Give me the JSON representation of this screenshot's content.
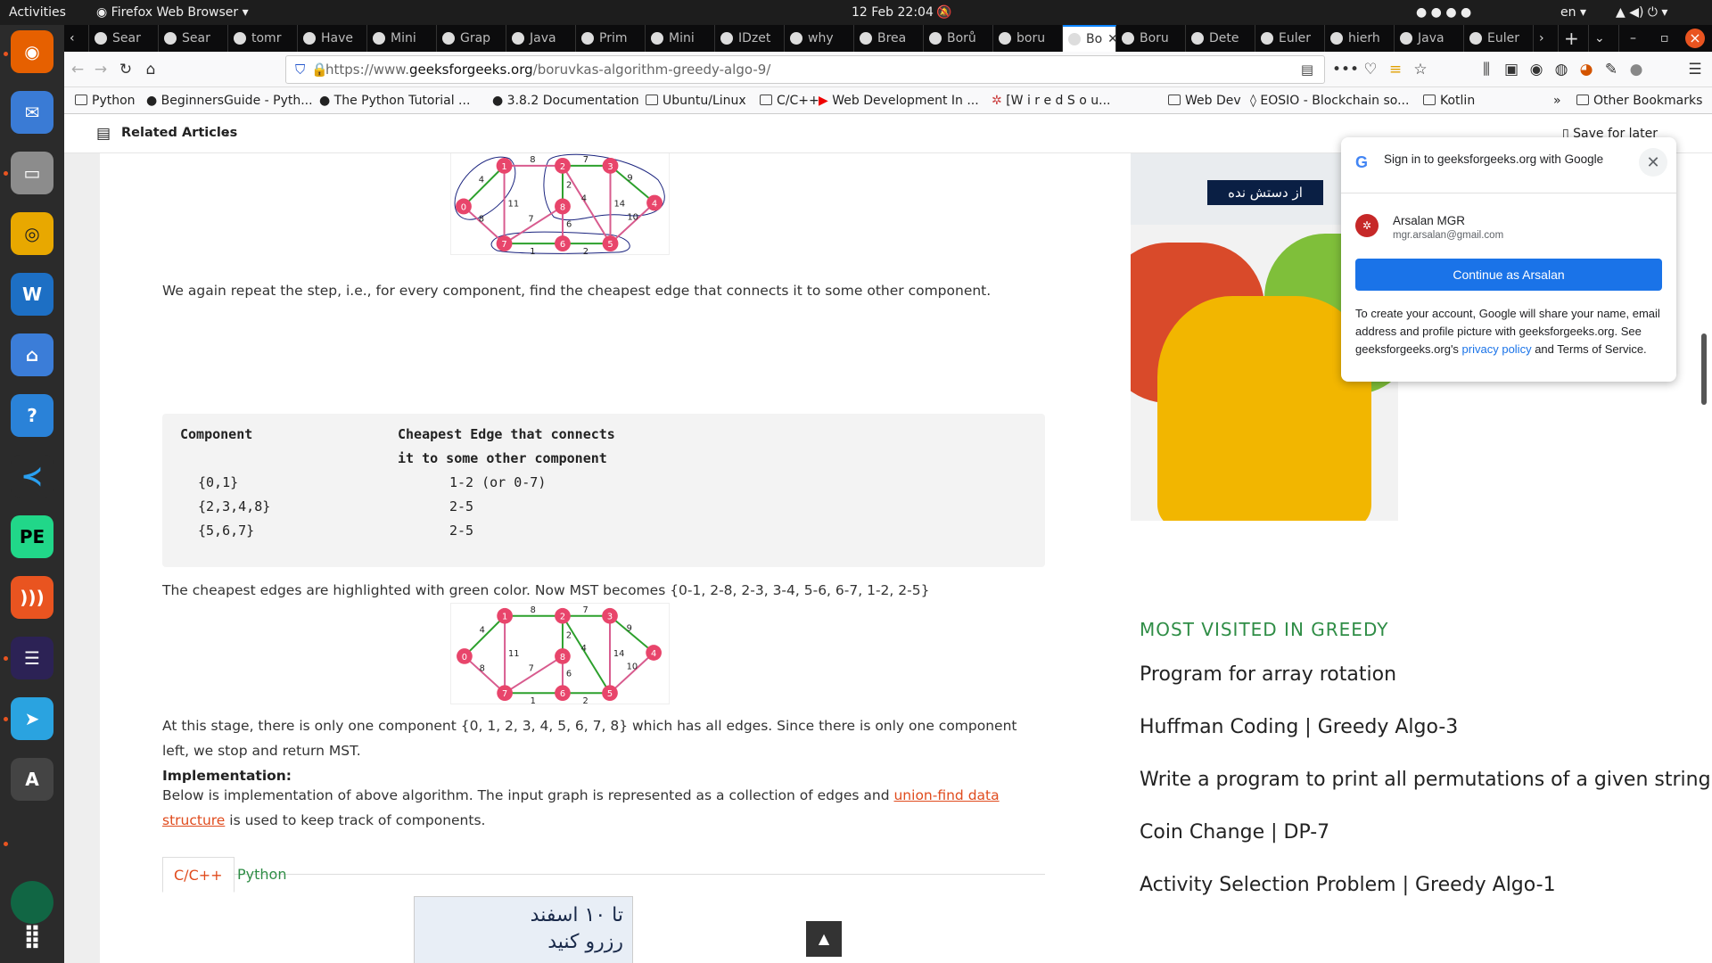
{
  "topbar": {
    "activities": "Activities",
    "app": "Firefox Web Browser",
    "clock": "12 Feb  22:04",
    "lang": "en"
  },
  "tabs": [
    "Sear",
    "Sear",
    "tomr",
    "Have",
    "Mini",
    "Grap",
    "Java",
    "Prim",
    "Mini",
    "IDzet",
    "why",
    "Brea",
    "Borů",
    "boru",
    "Bo",
    "Boru",
    "Dete",
    "Euler",
    "hierh",
    "Java",
    "Euler"
  ],
  "url": {
    "prefix": "https://www.",
    "domain": "geeksforgeeks.org",
    "path": "/boruvkas-algorithm-greedy-algo-9/"
  },
  "bookmarks": [
    "Python",
    "BeginnersGuide - Pyth...",
    "The Python Tutorial ...",
    "3.8.2 Documentation",
    "Ubuntu/Linux",
    "C/C++",
    "Web Development In ...",
    "[W i r e d   S o u...",
    "Web Dev",
    "EOSIO - Blockchain so...",
    "Kotlin",
    "Other Bookmarks"
  ],
  "related": {
    "label": "Related Articles",
    "save": "Save for later"
  },
  "article": {
    "p1": "We again repeat the step, i.e., for every component, find the cheapest edge that connects it to some other component.",
    "code_h1": "Component",
    "code_h2": "Cheapest Edge that connects",
    "code_h3": "it to some other component",
    "rows": [
      [
        "{0,1}",
        "1-2 (or 0-7)"
      ],
      [
        "{2,3,4,8}",
        "2-5"
      ],
      [
        "{5,6,7}",
        "2-5"
      ]
    ],
    "p2": "The cheapest edges are highlighted with green color. Now MST becomes {0-1, 2-8, 2-3, 3-4, 5-6, 6-7, 1-2, 2-5}",
    "p3": "At this stage, there is only one component {0, 1, 2, 3, 4, 5, 6, 7, 8} which has all edges. Since there is only one component left, we stop and return MST.",
    "impl": "Implementation:",
    "p4a": "Below is implementation of above algorithm. The input graph is represented as a collection of edges and ",
    "p4link": "union-find data structure",
    "p4b": " is used to keep track of components.",
    "tab1": "C/C++",
    "tab2": "Python",
    "ad_text1": "تا ۱۰ اسفند",
    "ad_text2": "رزرو کنید"
  },
  "graph": {
    "nodes": [
      "0",
      "1",
      "2",
      "3",
      "4",
      "5",
      "6",
      "7",
      "8"
    ],
    "edges": [
      [
        "0",
        "1",
        "4"
      ],
      [
        "1",
        "2",
        "8"
      ],
      [
        "2",
        "3",
        "7"
      ],
      [
        "3",
        "4",
        "9"
      ],
      [
        "0",
        "7",
        "8"
      ],
      [
        "1",
        "7",
        "11"
      ],
      [
        "2",
        "8",
        "2"
      ],
      [
        "2",
        "5",
        "4"
      ],
      [
        "3",
        "5",
        "14"
      ],
      [
        "4",
        "5",
        "10"
      ],
      [
        "7",
        "8",
        "7"
      ],
      [
        "8",
        "6",
        "6"
      ],
      [
        "7",
        "6",
        "1"
      ],
      [
        "6",
        "5",
        "2"
      ]
    ],
    "node_color": "#e8456b",
    "edge_color": "#d85b8e",
    "mst_color": "#2ca02c"
  },
  "sidebar": {
    "ad_text": "از دستش نده",
    "heading": "MOST VISITED IN GREEDY",
    "links": [
      "Program for array rotation",
      "Huffman Coding | Greedy Algo-3",
      "Write a program to print all permutations of a given string",
      "Coin Change | DP-7",
      "Activity Selection Problem | Greedy Algo-1"
    ]
  },
  "popup": {
    "title": "Sign in to geeksforgeeks.org with Google",
    "name": "Arsalan MGR",
    "email": "mgr.arsalan@gmail.com",
    "button": "Continue as Arsalan",
    "text": "To create your account, Google will share your name, email address and profile picture with geeksforgeeks.org. See geeksforgeeks.org's ",
    "privacy": "privacy policy",
    "tail": " and Terms of Service."
  }
}
